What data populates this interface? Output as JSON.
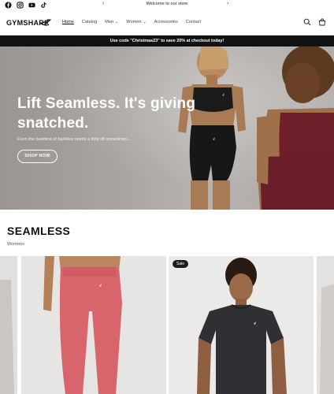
{
  "announcement": {
    "text": "Welcome to our store",
    "prev_icon": "chevron-left-icon",
    "next_icon": "chevron-right-icon"
  },
  "social": [
    "facebook-icon",
    "instagram-icon",
    "youtube-icon",
    "tiktok-icon"
  ],
  "header": {
    "logo": "GYMSHARK",
    "nav": [
      {
        "label": "Home",
        "active": true
      },
      {
        "label": "Catalog"
      },
      {
        "label": "Men",
        "dropdown": true
      },
      {
        "label": "Women",
        "dropdown": true
      },
      {
        "label": "Accessories"
      },
      {
        "label": "Contact"
      }
    ],
    "icons": [
      "search-icon",
      "cart-icon"
    ]
  },
  "promo": {
    "text": "Use code \"Christmas23\" to save 20% at checkout today!"
  },
  "hero": {
    "title": "Lift Seamless. It's giving snatched.",
    "subtitle": "Even the baddest of baddies needs a little lift sometimes...",
    "button": "SHOP NOW"
  },
  "section": {
    "title": "SEAMLESS",
    "subtitle": "Womens"
  },
  "products": [
    {
      "badge": ""
    },
    {
      "badge": ""
    },
    {
      "badge": "Sale"
    },
    {
      "badge": ""
    }
  ],
  "colors": {
    "promo_bg": "#121212",
    "accent": "#ffffff",
    "leggings": "#d9656c",
    "tee": "#2f3033",
    "hero_bg": "#aaa5a2"
  }
}
